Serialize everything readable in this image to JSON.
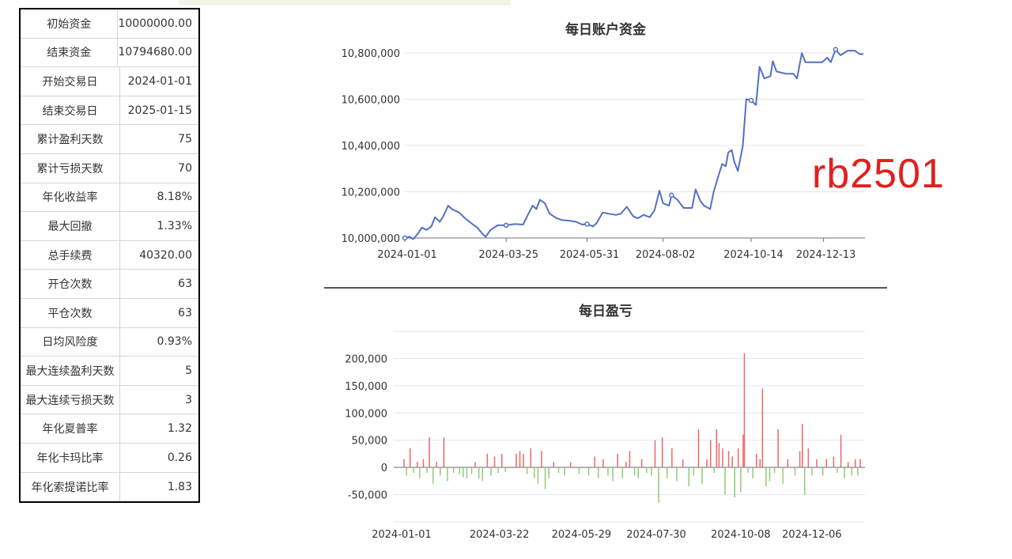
{
  "stats": [
    {
      "label": "初始资金",
      "value": "10000000.00"
    },
    {
      "label": "结束资金",
      "value": "10794680.00"
    },
    {
      "label": "开始交易日",
      "value": "2024-01-01"
    },
    {
      "label": "结束交易日",
      "value": "2025-01-15"
    },
    {
      "label": "累计盈利天数",
      "value": "75"
    },
    {
      "label": "累计亏损天数",
      "value": "70"
    },
    {
      "label": "年化收益率",
      "value": "8.18%"
    },
    {
      "label": "最大回撤",
      "value": "1.33%"
    },
    {
      "label": "总手续费",
      "value": "40320.00"
    },
    {
      "label": "开仓次数",
      "value": "63"
    },
    {
      "label": "平仓次数",
      "value": "63"
    },
    {
      "label": "日均风险度",
      "value": "0.93%"
    },
    {
      "label": "最大连续盈利天数",
      "value": "5"
    },
    {
      "label": "最大连续亏损天数",
      "value": "3"
    },
    {
      "label": "年化夏普率",
      "value": "1.32"
    },
    {
      "label": "年化卡玛比率",
      "value": "0.26"
    },
    {
      "label": "年化索提诺比率",
      "value": "1.83"
    }
  ],
  "watermark": "rb2501",
  "chart_data": [
    {
      "type": "line",
      "title": "每日账户资金",
      "color": "#5470c6",
      "ylim": [
        10000000,
        10800000
      ],
      "yticks": [
        "10,000,000",
        "10,200,000",
        "10,400,000",
        "10,600,000",
        "10,800,000"
      ],
      "xticks": [
        "2024-01-01",
        "2024-03-25",
        "2024-05-31",
        "2024-08-02",
        "2024-10-14",
        "2024-12-13"
      ],
      "xrange": [
        "2024-01-01",
        "2025-01-15"
      ],
      "series": [
        {
          "points": [
            [
              "2024-01-01",
              10000000
            ],
            [
              "2024-01-05",
              10005000
            ],
            [
              "2024-01-08",
              9995000
            ],
            [
              "2024-01-12",
              10020000
            ],
            [
              "2024-01-15",
              10045000
            ],
            [
              "2024-01-19",
              10035000
            ],
            [
              "2024-01-23",
              10050000
            ],
            [
              "2024-01-26",
              10090000
            ],
            [
              "2024-01-30",
              10070000
            ],
            [
              "2024-02-02",
              10095000
            ],
            [
              "2024-02-06",
              10140000
            ],
            [
              "2024-02-09",
              10125000
            ],
            [
              "2024-02-15",
              10110000
            ],
            [
              "2024-02-20",
              10085000
            ],
            [
              "2024-02-26",
              10060000
            ],
            [
              "2024-03-01",
              10045000
            ],
            [
              "2024-03-05",
              10020000
            ],
            [
              "2024-03-08",
              10005000
            ],
            [
              "2024-03-12",
              10035000
            ],
            [
              "2024-03-18",
              10055000
            ],
            [
              "2024-03-25",
              10055000
            ],
            [
              "2024-04-01",
              10060000
            ],
            [
              "2024-04-08",
              10058000
            ],
            [
              "2024-04-12",
              10100000
            ],
            [
              "2024-04-16",
              10140000
            ],
            [
              "2024-04-19",
              10125000
            ],
            [
              "2024-04-22",
              10165000
            ],
            [
              "2024-04-26",
              10150000
            ],
            [
              "2024-04-30",
              10105000
            ],
            [
              "2024-05-06",
              10085000
            ],
            [
              "2024-05-10",
              10078000
            ],
            [
              "2024-05-16",
              10075000
            ],
            [
              "2024-05-22",
              10070000
            ],
            [
              "2024-05-27",
              10058000
            ],
            [
              "2024-05-31",
              10060000
            ],
            [
              "2024-06-05",
              10050000
            ],
            [
              "2024-06-08",
              10065000
            ],
            [
              "2024-06-13",
              10110000
            ],
            [
              "2024-06-18",
              10105000
            ],
            [
              "2024-06-24",
              10100000
            ],
            [
              "2024-06-28",
              10105000
            ],
            [
              "2024-07-03",
              10135000
            ],
            [
              "2024-07-08",
              10095000
            ],
            [
              "2024-07-12",
              10085000
            ],
            [
              "2024-07-17",
              10100000
            ],
            [
              "2024-07-22",
              10090000
            ],
            [
              "2024-07-26",
              10120000
            ],
            [
              "2024-07-30",
              10205000
            ],
            [
              "2024-08-02",
              10150000
            ],
            [
              "2024-08-07",
              10140000
            ],
            [
              "2024-08-09",
              10185000
            ],
            [
              "2024-08-14",
              10165000
            ],
            [
              "2024-08-19",
              10130000
            ],
            [
              "2024-08-26",
              10130000
            ],
            [
              "2024-08-29",
              10210000
            ],
            [
              "2024-09-02",
              10160000
            ],
            [
              "2024-09-05",
              10140000
            ],
            [
              "2024-09-10",
              10125000
            ],
            [
              "2024-09-13",
              10200000
            ],
            [
              "2024-09-17",
              10270000
            ],
            [
              "2024-09-20",
              10320000
            ],
            [
              "2024-09-23",
              10310000
            ],
            [
              "2024-09-25",
              10370000
            ],
            [
              "2024-09-28",
              10380000
            ],
            [
              "2024-09-30",
              10330000
            ],
            [
              "2024-10-03",
              10290000
            ],
            [
              "2024-10-07",
              10395000
            ],
            [
              "2024-10-10",
              10600000
            ],
            [
              "2024-10-14",
              10595000
            ],
            [
              "2024-10-18",
              10575000
            ],
            [
              "2024-10-21",
              10740000
            ],
            [
              "2024-10-25",
              10690000
            ],
            [
              "2024-10-30",
              10700000
            ],
            [
              "2024-11-01",
              10765000
            ],
            [
              "2024-11-04",
              10720000
            ],
            [
              "2024-11-12",
              10710000
            ],
            [
              "2024-11-18",
              10710000
            ],
            [
              "2024-11-21",
              10690000
            ],
            [
              "2024-11-25",
              10800000
            ],
            [
              "2024-11-28",
              10760000
            ],
            [
              "2024-12-05",
              10760000
            ],
            [
              "2024-12-12",
              10760000
            ],
            [
              "2024-12-16",
              10780000
            ],
            [
              "2024-12-19",
              10760000
            ],
            [
              "2024-12-23",
              10815000
            ],
            [
              "2024-12-27",
              10790000
            ],
            [
              "2025-01-02",
              10810000
            ],
            [
              "2025-01-08",
              10810000
            ],
            [
              "2025-01-12",
              10795000
            ],
            [
              "2025-01-15",
              10795000
            ]
          ],
          "markers": [
            "2024-01-01",
            "2024-03-25",
            "2024-05-31",
            "2024-08-09",
            "2024-10-14",
            "2024-12-23"
          ]
        }
      ]
    },
    {
      "type": "bar",
      "title": "每日盈亏",
      "positive_color": "#ee6666",
      "negative_color": "#91cc75",
      "ylim": [
        -100000,
        250000
      ],
      "yticks": [
        "-50,000",
        "0",
        "50,000",
        "100,000",
        "150,000",
        "200,000"
      ],
      "xticks": [
        "2024-01-01",
        "2024-03-22",
        "2024-05-29",
        "2024-07-30",
        "2024-10-08",
        "2024-12-06"
      ],
      "xrange": [
        "2024-01-01",
        "2025-01-15"
      ],
      "values": [
        [
          "2024-01-03",
          15000
        ],
        [
          "2024-01-05",
          -15000
        ],
        [
          "2024-01-08",
          35000
        ],
        [
          "2024-01-11",
          -10000
        ],
        [
          "2024-01-14",
          10000
        ],
        [
          "2024-01-16",
          -20000
        ],
        [
          "2024-01-19",
          15000
        ],
        [
          "2024-01-22",
          -10000
        ],
        [
          "2024-01-24",
          55000
        ],
        [
          "2024-01-27",
          -30000
        ],
        [
          "2024-01-30",
          10000
        ],
        [
          "2024-02-02",
          -15000
        ],
        [
          "2024-02-05",
          55000
        ],
        [
          "2024-02-08",
          -25000
        ],
        [
          "2024-02-13",
          -10000
        ],
        [
          "2024-02-18",
          -12000
        ],
        [
          "2024-02-21",
          -18000
        ],
        [
          "2024-02-24",
          -20000
        ],
        [
          "2024-02-28",
          -12000
        ],
        [
          "2024-03-02",
          10000
        ],
        [
          "2024-03-05",
          -20000
        ],
        [
          "2024-03-08",
          -25000
        ],
        [
          "2024-03-12",
          25000
        ],
        [
          "2024-03-15",
          -15000
        ],
        [
          "2024-03-18",
          20000
        ],
        [
          "2024-03-21",
          -10000
        ],
        [
          "2024-03-24",
          25000
        ],
        [
          "2024-03-27",
          -8000
        ],
        [
          "2024-04-05",
          25000
        ],
        [
          "2024-04-08",
          30000
        ],
        [
          "2024-04-11",
          25000
        ],
        [
          "2024-04-14",
          -12000
        ],
        [
          "2024-04-17",
          35000
        ],
        [
          "2024-04-20",
          -20000
        ],
        [
          "2024-04-23",
          -30000
        ],
        [
          "2024-04-26",
          30000
        ],
        [
          "2024-04-29",
          -40000
        ],
        [
          "2024-05-02",
          -20000
        ],
        [
          "2024-05-06",
          10000
        ],
        [
          "2024-05-10",
          -10000
        ],
        [
          "2024-05-15",
          -15000
        ],
        [
          "2024-05-20",
          10000
        ],
        [
          "2024-05-27",
          -12000
        ],
        [
          "2024-06-04",
          -15000
        ],
        [
          "2024-06-09",
          20000
        ],
        [
          "2024-06-12",
          -20000
        ],
        [
          "2024-06-16",
          15000
        ],
        [
          "2024-06-20",
          -15000
        ],
        [
          "2024-06-24",
          -25000
        ],
        [
          "2024-06-28",
          25000
        ],
        [
          "2024-07-02",
          -20000
        ],
        [
          "2024-07-05",
          10000
        ],
        [
          "2024-07-08",
          30000
        ],
        [
          "2024-07-12",
          -15000
        ],
        [
          "2024-07-15",
          -20000
        ],
        [
          "2024-07-18",
          15000
        ],
        [
          "2024-07-22",
          -10000
        ],
        [
          "2024-07-26",
          -15000
        ],
        [
          "2024-07-29",
          50000
        ],
        [
          "2024-08-01",
          -65000
        ],
        [
          "2024-08-04",
          55000
        ],
        [
          "2024-08-08",
          -20000
        ],
        [
          "2024-08-12",
          35000
        ],
        [
          "2024-08-16",
          -25000
        ],
        [
          "2024-08-21",
          15000
        ],
        [
          "2024-08-26",
          -35000
        ],
        [
          "2024-08-30",
          -15000
        ],
        [
          "2024-09-03",
          70000
        ],
        [
          "2024-09-06",
          -30000
        ],
        [
          "2024-09-10",
          15000
        ],
        [
          "2024-09-13",
          50000
        ],
        [
          "2024-09-16",
          -10000
        ],
        [
          "2024-09-18",
          70000
        ],
        [
          "2024-09-20",
          45000
        ],
        [
          "2024-09-23",
          35000
        ],
        [
          "2024-09-25",
          -50000
        ],
        [
          "2024-09-28",
          30000
        ],
        [
          "2024-10-01",
          20000
        ],
        [
          "2024-10-03",
          -55000
        ],
        [
          "2024-10-06",
          35000
        ],
        [
          "2024-10-08",
          -45000
        ],
        [
          "2024-10-10",
          60000
        ],
        [
          "2024-10-11",
          210000
        ],
        [
          "2024-10-14",
          -10000
        ],
        [
          "2024-10-18",
          -20000
        ],
        [
          "2024-10-21",
          25000
        ],
        [
          "2024-10-24",
          15000
        ],
        [
          "2024-10-26",
          145000
        ],
        [
          "2024-10-29",
          -35000
        ],
        [
          "2024-11-01",
          -25000
        ],
        [
          "2024-11-05",
          -10000
        ],
        [
          "2024-11-08",
          70000
        ],
        [
          "2024-11-12",
          -30000
        ],
        [
          "2024-11-16",
          15000
        ],
        [
          "2024-11-22",
          -15000
        ],
        [
          "2024-11-26",
          30000
        ],
        [
          "2024-11-28",
          80000
        ],
        [
          "2024-11-30",
          -50000
        ],
        [
          "2024-12-03",
          35000
        ],
        [
          "2024-12-06",
          -15000
        ],
        [
          "2024-12-10",
          15000
        ],
        [
          "2024-12-15",
          -15000
        ],
        [
          "2024-12-18",
          15000
        ],
        [
          "2024-12-24",
          20000
        ],
        [
          "2024-12-27",
          -10000
        ],
        [
          "2024-12-30",
          60000
        ],
        [
          "2025-01-02",
          -20000
        ],
        [
          "2025-01-05",
          10000
        ],
        [
          "2025-01-08",
          -15000
        ],
        [
          "2025-01-11",
          15000
        ],
        [
          "2025-01-13",
          -15000
        ],
        [
          "2025-01-15",
          15000
        ]
      ]
    }
  ]
}
